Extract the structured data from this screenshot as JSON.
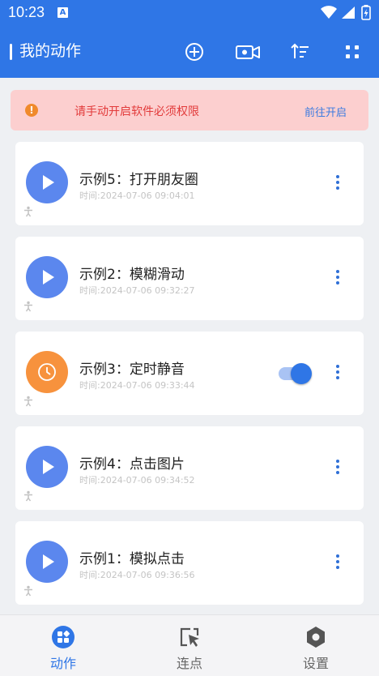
{
  "status_bar": {
    "time": "10:23",
    "notif_badge": "A"
  },
  "app_bar": {
    "title": "我的动作",
    "icons": [
      "add-circle-icon",
      "video-camera-icon",
      "sort-icon",
      "fullscreen-icon"
    ]
  },
  "banner": {
    "message": "请手动开启软件必须权限",
    "link_label": "前往开启",
    "icon": "warning-icon"
  },
  "actions": [
    {
      "title": "示例5：打开朋友圈",
      "time": "时间:2024-07-06 09:04:01",
      "type": "play",
      "toggle": null
    },
    {
      "title": "示例2：模糊滑动",
      "time": "时间:2024-07-06 09:32:27",
      "type": "play",
      "toggle": null
    },
    {
      "title": "示例3：定时静音",
      "time": "时间:2024-07-06 09:33:44",
      "type": "timer",
      "toggle": true
    },
    {
      "title": "示例4：点击图片",
      "time": "时间:2024-07-06 09:34:52",
      "type": "play",
      "toggle": null
    },
    {
      "title": "示例1：模拟点击",
      "time": "时间:2024-07-06 09:36:56",
      "type": "play",
      "toggle": null
    }
  ],
  "bottom_nav": [
    {
      "label": "动作",
      "icon": "actions-grid-icon",
      "active": true
    },
    {
      "label": "连点",
      "icon": "cursor-select-icon",
      "active": false
    },
    {
      "label": "设置",
      "icon": "settings-hex-icon",
      "active": false
    }
  ],
  "colors": {
    "primary": "#2f76e6",
    "play": "#5b87ee",
    "timer": "#f7923d",
    "banner_bg": "#fccfcf",
    "banner_text": "#e23b3b"
  }
}
